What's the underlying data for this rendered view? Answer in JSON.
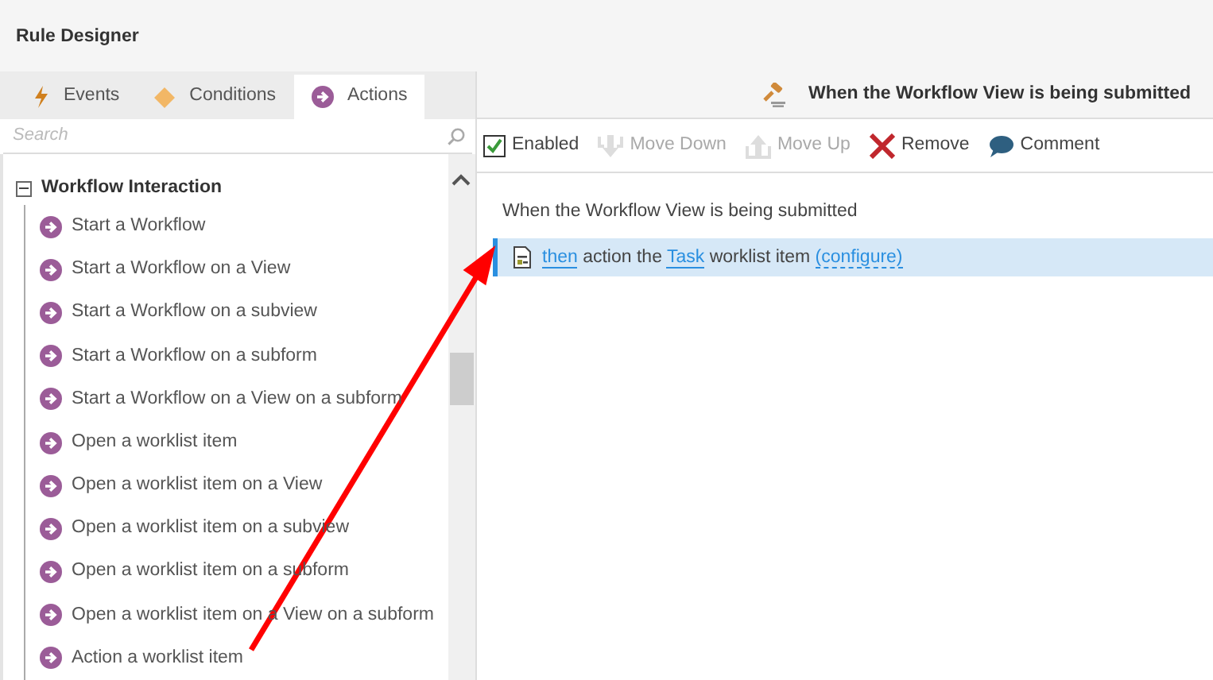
{
  "window": {
    "title": "Rule Designer"
  },
  "tabs": [
    {
      "label": "Events",
      "kind": "events",
      "selected": false
    },
    {
      "label": "Conditions",
      "kind": "conditions",
      "selected": false
    },
    {
      "label": "Actions",
      "kind": "actions",
      "selected": true
    }
  ],
  "search": {
    "placeholder": "Search"
  },
  "tree": {
    "label": "Workflow Interaction",
    "expanded": true,
    "children": [
      {
        "label": "Start a Workflow"
      },
      {
        "label": "Start a Workflow on a View"
      },
      {
        "label": "Start a Workflow on a subview"
      },
      {
        "label": "Start a Workflow on a subform"
      },
      {
        "label": "Start a Workflow on a View on a subform"
      },
      {
        "label": "Open a worklist item"
      },
      {
        "label": "Open a worklist item on a View"
      },
      {
        "label": "Open a worklist item on a subview"
      },
      {
        "label": "Open a worklist item on a subform"
      },
      {
        "label": "Open a worklist item on a View on a subform"
      },
      {
        "label": "Action a worklist item"
      }
    ]
  },
  "rule_header": {
    "title": "When the Workflow View is being submitted"
  },
  "toolbar": [
    {
      "kind": "checkbox",
      "label": "Enabled",
      "checked": true,
      "disabled": false
    },
    {
      "kind": "move-down",
      "label": "Move Down",
      "disabled": true
    },
    {
      "kind": "move-up",
      "label": "Move Up",
      "disabled": true
    },
    {
      "kind": "remove",
      "label": "Remove",
      "disabled": false
    },
    {
      "kind": "comment",
      "label": "Comment",
      "disabled": false
    }
  ],
  "rule": {
    "event": "When the Workflow View is being submitted",
    "action": {
      "selected": true,
      "parts": [
        {
          "text": "then",
          "link": true
        },
        {
          "text": "action the",
          "link": false
        },
        {
          "text": "Task",
          "link": true
        },
        {
          "text": "worklist item",
          "link": false
        },
        {
          "text": "(configure)",
          "link": true
        }
      ]
    }
  }
}
